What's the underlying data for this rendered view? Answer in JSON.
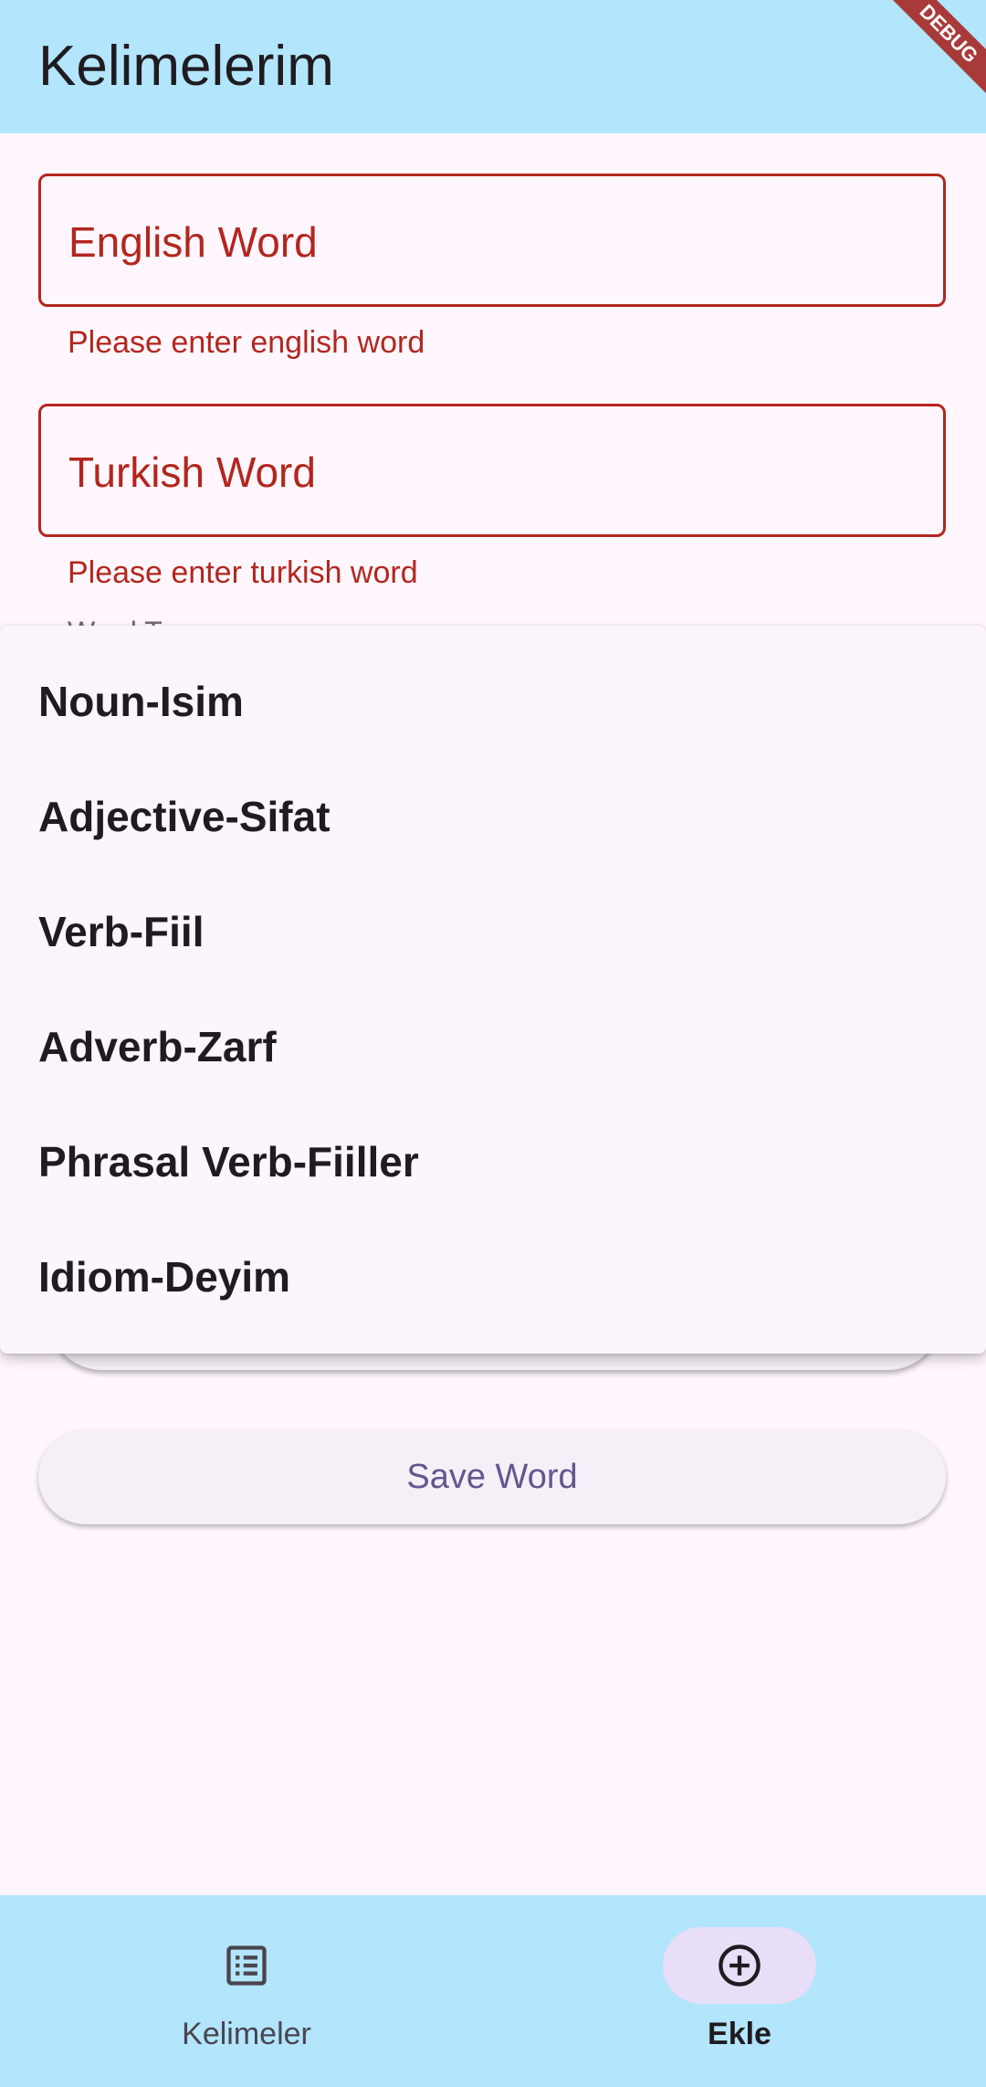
{
  "app_bar": {
    "title": "Kelimelerim",
    "debug_banner": "DEBUG"
  },
  "form": {
    "english_field": {
      "label": "English Word",
      "error": "Please enter english word"
    },
    "turkish_field": {
      "label": "Turkish Word",
      "error": "Please enter turkish word"
    },
    "word_type": {
      "label": "Word Type"
    },
    "save_button_label": "Save Word"
  },
  "dropdown_menu": {
    "items": [
      {
        "label": "Noun-Isim"
      },
      {
        "label": "Adjective-Sifat"
      },
      {
        "label": "Verb-Fiil"
      },
      {
        "label": "Adverb-Zarf"
      },
      {
        "label": "Phrasal Verb-Fiiller"
      },
      {
        "label": "Idiom-Deyim"
      }
    ]
  },
  "bottom_nav": {
    "items": [
      {
        "label": "Kelimeler",
        "icon": "list-icon",
        "active": false
      },
      {
        "label": "Ekle",
        "icon": "add-circle-icon",
        "active": true
      }
    ]
  },
  "colors": {
    "app_bar": "#b3e5fc",
    "error": "#b3261e",
    "background": "#fff7fd",
    "button_text": "#65558f",
    "nav_indicator": "#e8def8"
  }
}
